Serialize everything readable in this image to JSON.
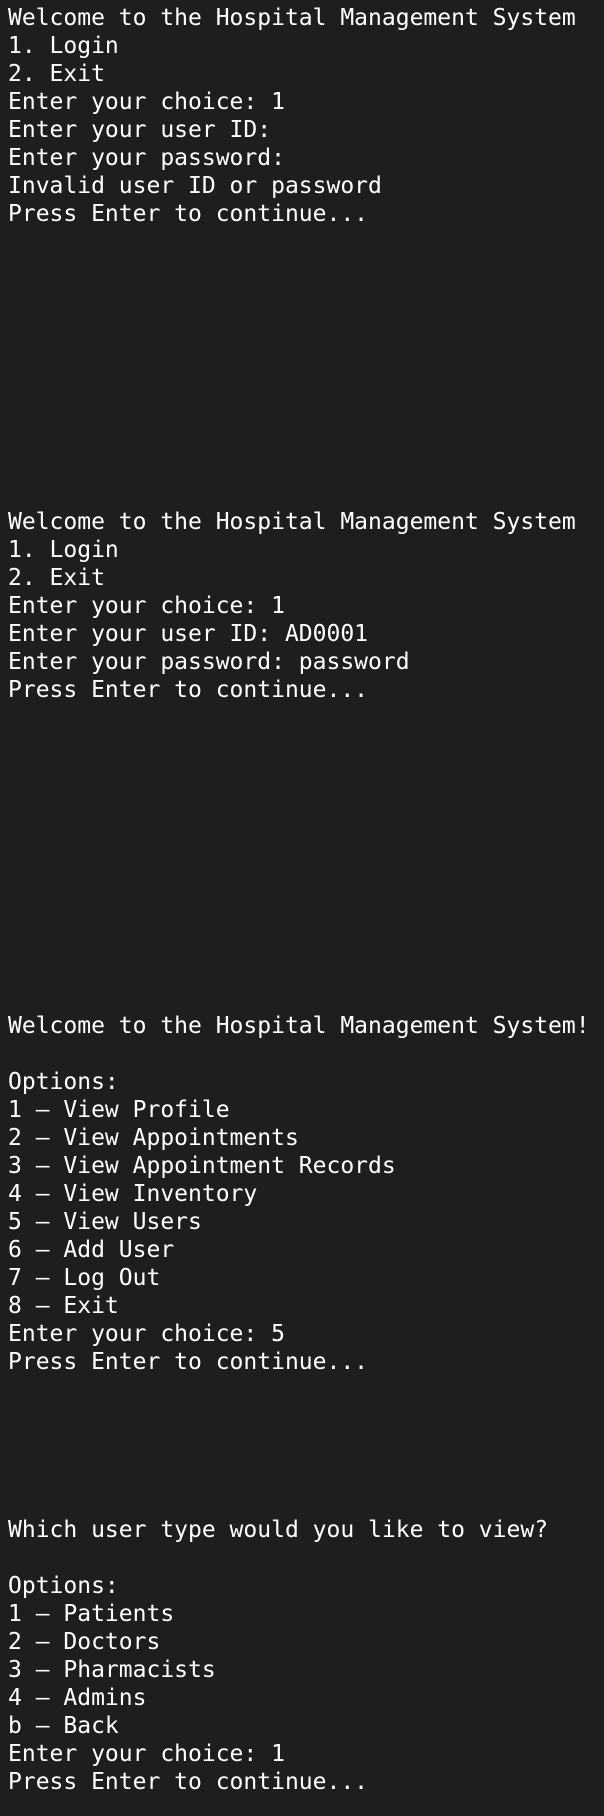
{
  "blocks": [
    {
      "lines": [
        "Welcome to the Hospital Management System",
        "1. Login",
        "2. Exit",
        "Enter your choice: 1",
        "Enter your user ID:",
        "Enter your password:",
        "Invalid user ID or password",
        "Press Enter to continue..."
      ]
    },
    {
      "lines": [
        "Welcome to the Hospital Management System",
        "1. Login",
        "2. Exit",
        "Enter your choice: 1",
        "Enter your user ID: AD0001",
        "Enter your password: password",
        "Press Enter to continue..."
      ]
    },
    {
      "lines": [
        "Welcome to the Hospital Management System!",
        "",
        "Options:",
        "1 – View Profile",
        "2 – View Appointments",
        "3 – View Appointment Records",
        "4 – View Inventory",
        "5 – View Users",
        "6 – Add User",
        "7 – Log Out",
        "8 – Exit",
        "Enter your choice: 5",
        "Press Enter to continue..."
      ]
    },
    {
      "lines": [
        "Which user type would you like to view?",
        "",
        "Options:",
        "1 – Patients",
        "2 – Doctors",
        "3 – Pharmacists",
        "4 – Admins",
        "b – Back",
        "Enter your choice: 1",
        "Press Enter to continue..."
      ]
    }
  ]
}
